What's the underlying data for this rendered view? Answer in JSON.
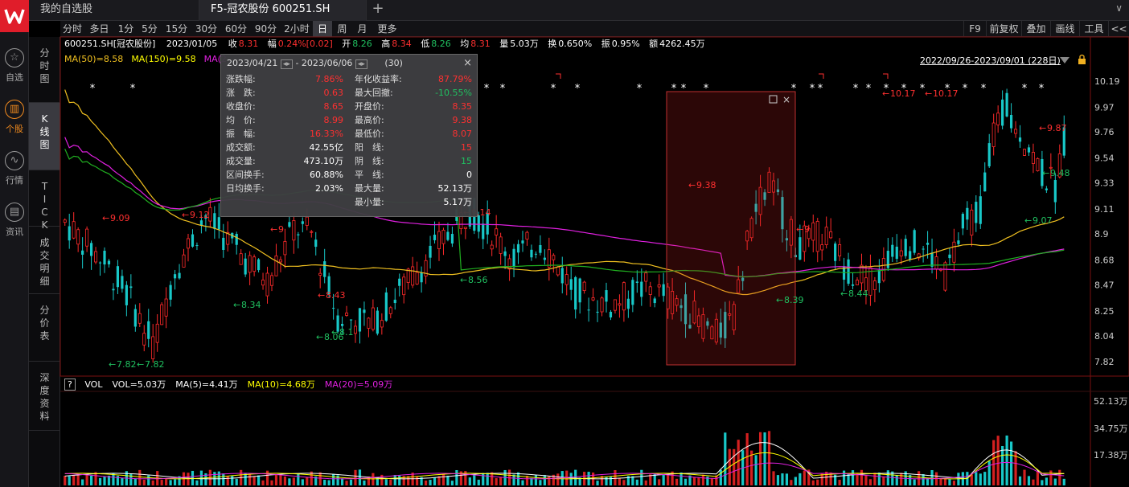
{
  "left_nav": {
    "items": [
      {
        "label": "自选",
        "icon": "star-icon"
      },
      {
        "label": "个股",
        "icon": "candle-icon"
      },
      {
        "label": "行情",
        "icon": "trend-icon"
      },
      {
        "label": "资讯",
        "icon": "news-icon"
      }
    ]
  },
  "tabs": [
    {
      "label": "我的自选股"
    },
    {
      "label": "F5-冠农股份 600251.SH"
    }
  ],
  "periods": [
    "分时",
    "多日",
    "1分",
    "5分",
    "15分",
    "30分",
    "60分",
    "90分",
    "2小时",
    "日",
    "周",
    "月",
    "更多"
  ],
  "active_period": "日",
  "right_tools": [
    "F9",
    "前复权",
    "叠加",
    "画线",
    "工具",
    "<<"
  ],
  "vertical_tabs": [
    "分时图",
    "K线图",
    "TICK",
    "成交明细",
    "分价表",
    "深度资料"
  ],
  "info": {
    "code": "600251.SH[冠农股份]",
    "date": "2023/01/05",
    "close_label": "收",
    "close": "8.31",
    "range_label": "幅",
    "range": "0.24%[0.02]",
    "open_label": "开",
    "open": "8.26",
    "high_label": "高",
    "high": "8.34",
    "low_label": "低",
    "low": "8.26",
    "avg_label": "均",
    "avg": "8.31",
    "vol_label": "量",
    "vol": "5.03万",
    "turn_label": "换",
    "turn": "0.650%",
    "amp_label": "振",
    "amp": "0.95%",
    "amt_label": "额",
    "amt": "4262.45万"
  },
  "ma_legend": [
    {
      "text": "MA(50)=8.58",
      "color": "#f0c020"
    },
    {
      "text": "MA(150)=9.58",
      "color": "#ffff00"
    },
    {
      "text": "MA(2",
      "color": "#e020e0"
    }
  ],
  "date_range": "2022/09/26-2023/09/01 (228日)",
  "popup": {
    "from": "2023/04/21",
    "to": "2023/06/06",
    "count": "(30)",
    "left": [
      {
        "label": "涨跌幅:",
        "value": "7.86%",
        "color": "#ff3030"
      },
      {
        "label": "涨　跌:",
        "value": "0.63",
        "color": "#ff3030"
      },
      {
        "label": "收盘价:",
        "value": "8.65",
        "color": "#ff3030"
      },
      {
        "label": "均　价:",
        "value": "8.99",
        "color": "#ff3030"
      },
      {
        "label": "振　幅:",
        "value": "16.33%",
        "color": "#ff3030"
      },
      {
        "label": "成交额:",
        "value": "42.55亿",
        "color": "#ffffff"
      },
      {
        "label": "成交量:",
        "value": "473.10万",
        "color": "#ffffff"
      },
      {
        "label": "区间换手:",
        "value": "60.88%",
        "color": "#ffffff"
      },
      {
        "label": "日均换手:",
        "value": "2.03%",
        "color": "#ffffff"
      }
    ],
    "right": [
      {
        "label": "年化收益率:",
        "value": "87.79%",
        "color": "#ff3030"
      },
      {
        "label": "最大回撤:",
        "value": "-10.55%",
        "color": "#20c060"
      },
      {
        "label": "开盘价:",
        "value": "8.35",
        "color": "#ff3030"
      },
      {
        "label": "最高价:",
        "value": "9.38",
        "color": "#ff3030"
      },
      {
        "label": "最低价:",
        "value": "8.07",
        "color": "#ff3030"
      },
      {
        "label": "阳　线:",
        "value": "15",
        "color": "#ff3030"
      },
      {
        "label": "阴　线:",
        "value": "15",
        "color": "#20c060"
      },
      {
        "label": "平　线:",
        "value": "0",
        "color": "#ffffff"
      },
      {
        "label": "最大量:",
        "value": "52.13万",
        "color": "#ffffff"
      },
      {
        "label": "最小量:",
        "value": "5.17万",
        "color": "#ffffff"
      }
    ]
  },
  "vol_header": [
    {
      "text": "VOL",
      "color": "#ffffff"
    },
    {
      "text": "VOL=5.03万",
      "color": "#ffffff"
    },
    {
      "text": "MA(5)=4.41万",
      "color": "#ffffff"
    },
    {
      "text": "MA(10)=4.68万",
      "color": "#ffff00"
    },
    {
      "text": "MA(20)=5.09万",
      "color": "#e020e0"
    }
  ],
  "chart_data": {
    "type": "candlestick",
    "y_ticks": [
      "10.19",
      "9.97",
      "9.76",
      "9.54",
      "9.33",
      "9.11",
      "8.9",
      "8.68",
      "8.47",
      "8.25",
      "8.04",
      "7.82"
    ],
    "vol_ticks": [
      "52.13万",
      "34.75万",
      "17.38万"
    ],
    "annotations": [
      {
        "text": "9.09",
        "color": "#ff3030"
      },
      {
        "text": "9.12",
        "color": "#ff3030"
      },
      {
        "text": "8.34",
        "color": "#20c060"
      },
      {
        "text": "9",
        "color": "#ff3030"
      },
      {
        "text": "8.43",
        "color": "#ff3030"
      },
      {
        "text": "8.06",
        "color": "#20c060"
      },
      {
        "text": "8.1",
        "color": "#20c060"
      },
      {
        "text": "7.82",
        "color": "#20c060"
      },
      {
        "text": "7.82",
        "color": "#20c060"
      },
      {
        "text": "9.14",
        "color": "#ff3030"
      },
      {
        "text": "8.56",
        "color": "#20c060"
      },
      {
        "text": "9.38",
        "color": "#ff3030"
      },
      {
        "text": "9",
        "color": "#ff3030"
      },
      {
        "text": "8.39",
        "color": "#20c060"
      },
      {
        "text": "8.44",
        "color": "#20c060"
      },
      {
        "text": "10.17",
        "color": "#ff3030"
      },
      {
        "text": "10.17",
        "color": "#ff3030"
      },
      {
        "text": "9.87",
        "color": "#ff3030"
      },
      {
        "text": "9.48",
        "color": "#20c060"
      },
      {
        "text": "9.07",
        "color": "#20c060"
      }
    ]
  }
}
